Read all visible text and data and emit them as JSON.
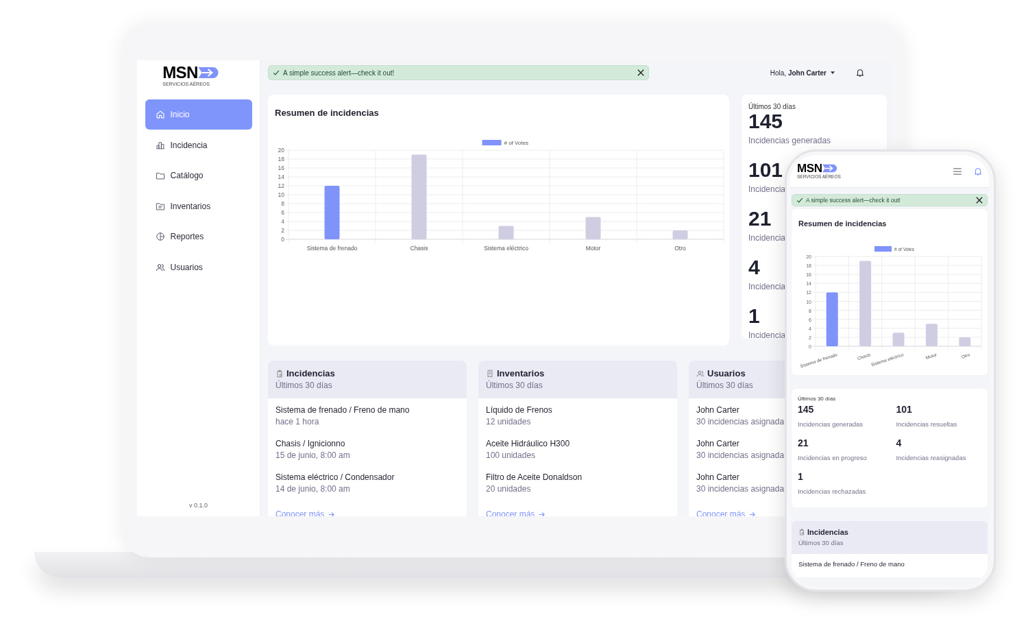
{
  "desktop": {
    "logo": {
      "mark": "MSN",
      "subtitle": "SERVICIOS AÉREOS"
    },
    "nav": [
      {
        "label": "Inicio",
        "kind": "home",
        "selected": true
      },
      {
        "label": "Incidencia",
        "kind": "chart",
        "selected": false
      },
      {
        "label": "Catálogo",
        "kind": "folder",
        "selected": false
      },
      {
        "label": "Inventarios",
        "kind": "drawer",
        "selected": false
      },
      {
        "label": "Reportes",
        "kind": "pie",
        "selected": false
      },
      {
        "label": "Usuarios",
        "kind": "users",
        "selected": false
      }
    ],
    "version": "v 0.1.0",
    "alert": {
      "text": "A simple success alert—check it out!"
    },
    "greeting": {
      "prefix": "Hola,",
      "name": "John Carter"
    },
    "chart_card": {
      "title": "Resumen de incidencias",
      "chart_data": {
        "type": "bar",
        "grid": true,
        "categories": [
          "Sistema de frenado",
          "Chasis",
          "Sistema eléctrico",
          "Motor",
          "Otro"
        ],
        "series": [
          {
            "name": "# of Votes",
            "color": "#7f93fb",
            "colors": [
              "#7f93fb",
              "#cfcde2",
              "#cfcde2",
              "#cfcde2",
              "#cfcde2"
            ],
            "values": [
              12,
              19,
              3,
              5,
              2
            ]
          }
        ],
        "ylim": [
          0,
          20
        ],
        "yticks": [
          0,
          2,
          4,
          6,
          8,
          10,
          12,
          14,
          16,
          18,
          20
        ]
      }
    },
    "stats": {
      "period": "Últimos 30 días",
      "items": [
        {
          "value": "145",
          "label": "Incidencias generadas"
        },
        {
          "value": "101",
          "label": "Incidencia"
        },
        {
          "value": "21",
          "label": "Incidencia"
        },
        {
          "value": "4",
          "label": "Incidencia"
        },
        {
          "value": "1",
          "label": "Incidencia"
        }
      ]
    },
    "lists": [
      {
        "title": "Incidencias",
        "kind": "clipboard",
        "subtitle": "Últimos 30 días",
        "rows": [
          {
            "primary": "Sistema de frenado / Freno de mano",
            "secondary": "hace 1 hora"
          },
          {
            "primary": "Chasis / Ignicionno",
            "secondary": "15 de junio, 8:00 am"
          },
          {
            "primary": "Sistema eléctrico / Condensador",
            "secondary": "14 de junio, 8:00 am"
          }
        ],
        "link": "Conocer más"
      },
      {
        "title": "Inventarios",
        "kind": "receipt",
        "subtitle": "Últimos 30 días",
        "rows": [
          {
            "primary": "Líquido de Frenos",
            "secondary": "12 unidades"
          },
          {
            "primary": "Aceite Hidráulico H300",
            "secondary": "100 unidades"
          },
          {
            "primary": "Filtro de Aceite Donaldson",
            "secondary": "20 unidades"
          }
        ],
        "link": "Conocer más"
      },
      {
        "title": "Usuarios",
        "kind": "users",
        "subtitle": "Últimos 30 días",
        "rows": [
          {
            "primary": "John Carter",
            "secondary": "30 incidencias asignada"
          },
          {
            "primary": "John Carter",
            "secondary": "30 incidencias asignada"
          },
          {
            "primary": "John Carter",
            "secondary": "30 incidencias asignada"
          }
        ],
        "link": "Conocer más"
      }
    ]
  },
  "phone": {
    "logo": {
      "mark": "MSN",
      "subtitle": "SERVICIOS AÉREOS"
    },
    "alert": {
      "text": "A simple success alert—check it out!"
    },
    "chart_card": {
      "title": "Resumen de incidencias",
      "chart_data": {
        "type": "bar",
        "grid": true,
        "categories": [
          "Sistema de frenado",
          "Chasis",
          "Sistema eléctrico",
          "Motor",
          "Otro"
        ],
        "series": [
          {
            "name": "# of Votes",
            "color": "#7f93fb",
            "colors": [
              "#7f93fb",
              "#cfcde2",
              "#cfcde2",
              "#cfcde2",
              "#cfcde2"
            ],
            "values": [
              12,
              19,
              3,
              5,
              2
            ]
          }
        ],
        "ylim": [
          0,
          20
        ],
        "yticks": [
          0,
          2,
          4,
          6,
          8,
          10,
          12,
          14,
          16,
          18,
          20
        ]
      }
    },
    "stats": {
      "period": "Últimos 30 días",
      "items": [
        {
          "value": "145",
          "label": "Incidencias generadas"
        },
        {
          "value": "101",
          "label": "Incidencias resueltas"
        },
        {
          "value": "21",
          "label": "Incidencias en progreso"
        },
        {
          "value": "4",
          "label": "Incidencias reasignadas"
        },
        {
          "value": "1",
          "label": "Incidencias rechazadas"
        }
      ]
    },
    "list": {
      "title": "Incidencias",
      "kind": "clipboard",
      "subtitle": "Últimos 30 días",
      "rows": [
        {
          "primary": "Sistema de frenado / Freno de mano"
        }
      ]
    }
  }
}
